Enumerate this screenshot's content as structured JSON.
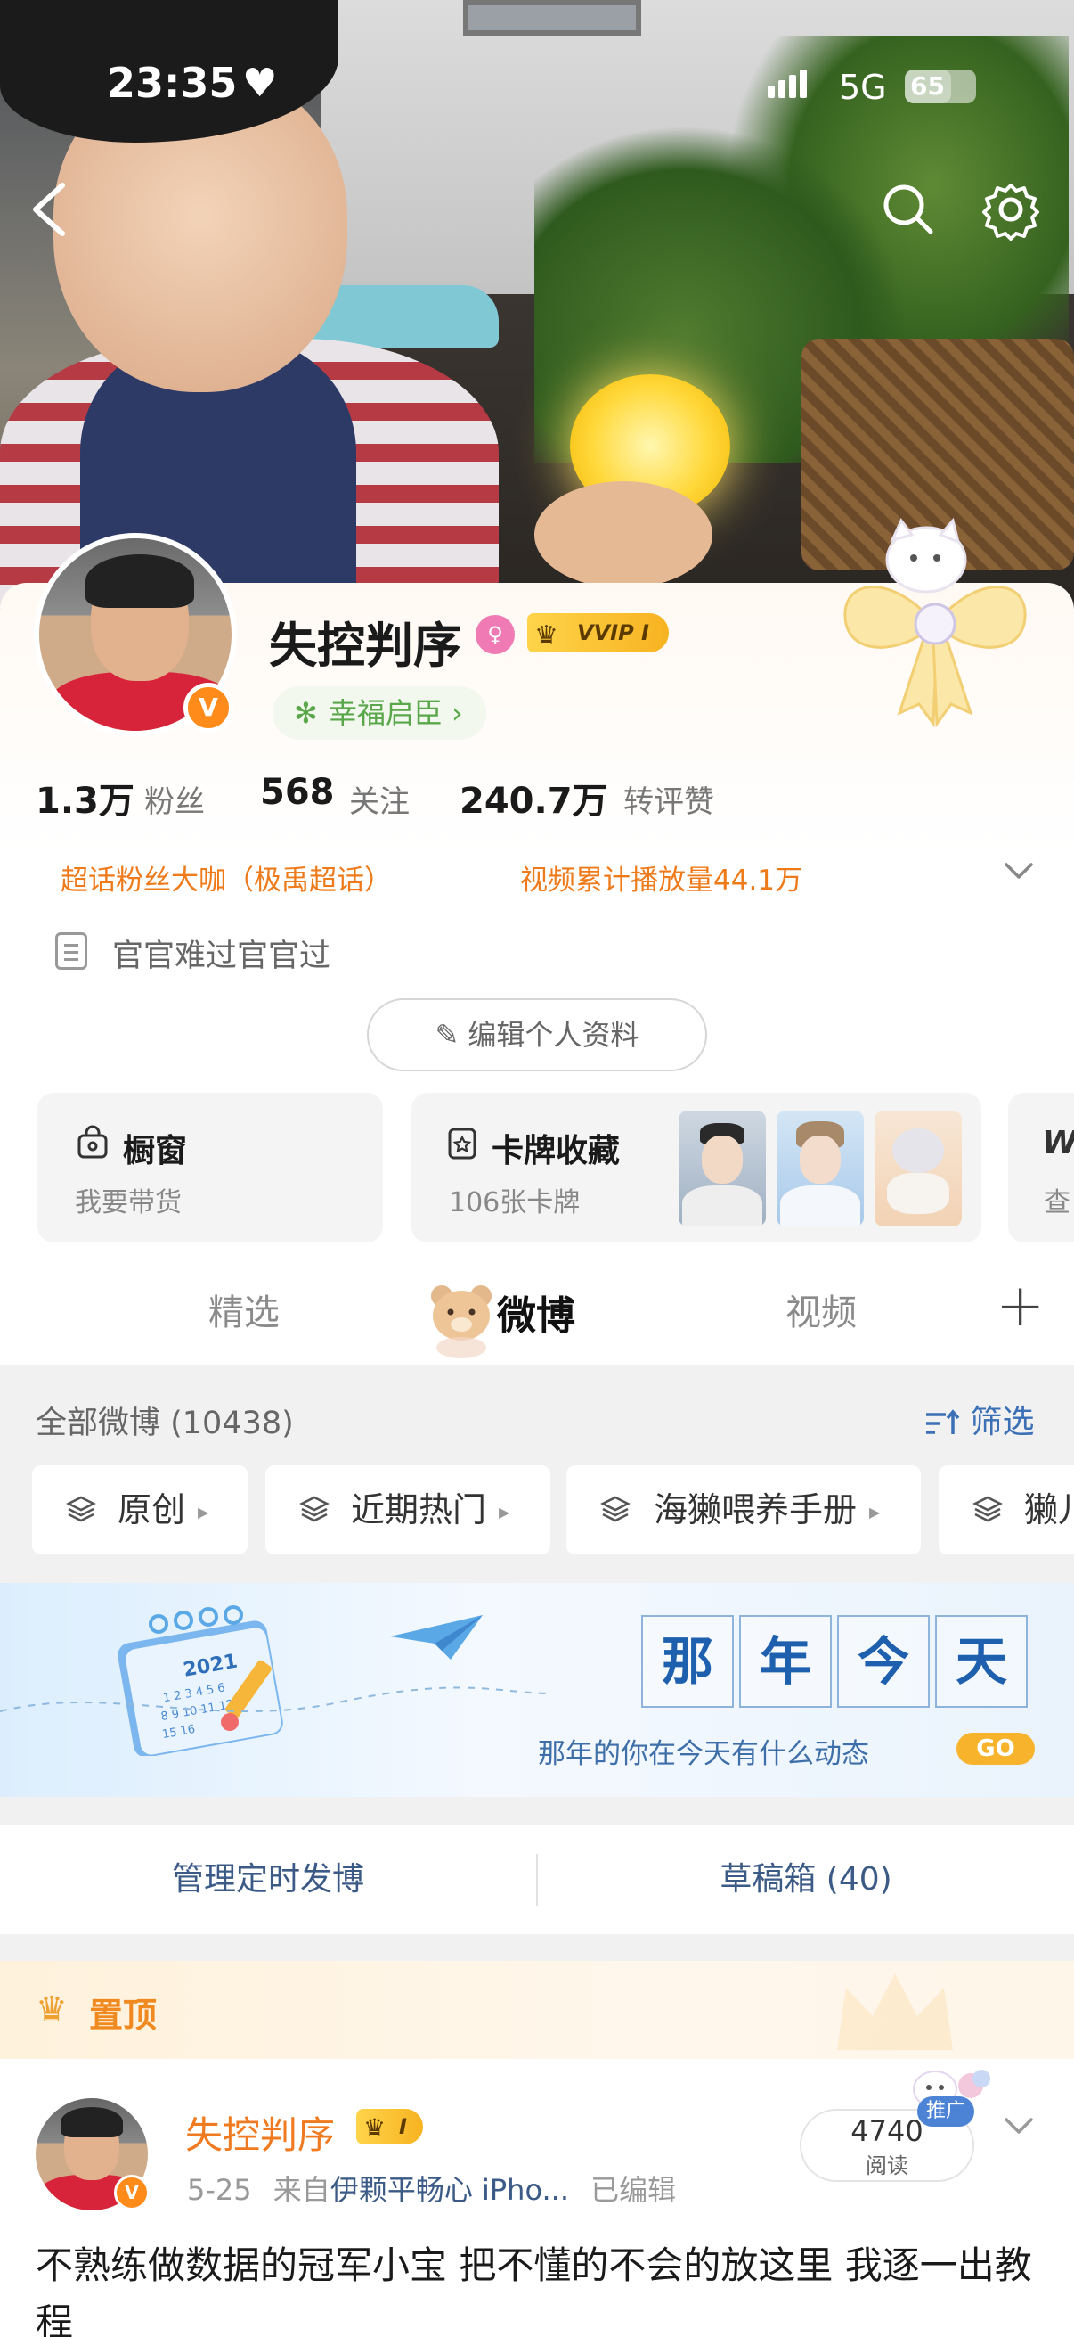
{
  "status_bar": {
    "time": "23:35",
    "network": "5G",
    "battery": "65",
    "battery_level": 0.65
  },
  "profile": {
    "name": "失控判序",
    "vip_badge": "VVIP I",
    "avatar_badge": "V",
    "title_chip": "幸福启臣 ›",
    "stats": [
      {
        "value": "1.3万",
        "label": "粉丝"
      },
      {
        "value": "568",
        "label": "关注"
      },
      {
        "value": "240.7万",
        "label": "转评赞"
      }
    ],
    "honors": [
      "超话粉丝大咖（极禹超话）",
      "视频累计播放量44.1万"
    ],
    "bio": "官官难过官官过",
    "edit_button": "编辑个人资料"
  },
  "features": [
    {
      "title": "橱窗",
      "subtitle": "我要带货"
    },
    {
      "title": "卡牌收藏",
      "subtitle": "106张卡牌"
    },
    {
      "title": "",
      "subtitle": "查"
    }
  ],
  "tabs": {
    "featured": "精选",
    "weibo": "微博",
    "video": "视频",
    "add": "+"
  },
  "feed": {
    "count_label": "全部微博 (10438)",
    "filter_label": "筛选",
    "chips": [
      "原创",
      "近期热门",
      "海獭喂养手册",
      "獭儿"
    ]
  },
  "banner": {
    "chars": [
      "那",
      "年",
      "今",
      "天"
    ],
    "subtitle": "那年的你在今天有什么动态",
    "go": "GO",
    "calendar_year": "2021"
  },
  "manage": {
    "scheduled": "管理定时发博",
    "drafts": "草稿箱 (40)"
  },
  "pinned": {
    "label": "置顶",
    "author": "失控判序",
    "vip": "I",
    "avatar_badge": "V",
    "date": "5-25",
    "source_prefix": "来自",
    "source": "伊颗平畅心 iPho...",
    "edited": "已编辑",
    "read_count": "4740",
    "read_label": "阅读",
    "promote": "推广",
    "text": "不熟练做数据的冠军小宝 把不懂的不会的放这里 我逐一出教程"
  },
  "colors": {
    "accent_orange": "#ef7a1a",
    "link_blue": "#3b5a86",
    "banner_blue": "#1e5fae"
  },
  "icons": [
    "back-arrow-icon",
    "search-icon",
    "gear-icon",
    "heart-icon",
    "gender-female-icon",
    "crown-icon",
    "clover-icon",
    "chevron-down-icon",
    "document-icon",
    "pencil-icon",
    "shopping-bag-icon",
    "card-icon",
    "filter-icon",
    "layers-icon",
    "paper-plane-icon",
    "calendar-icon"
  ]
}
